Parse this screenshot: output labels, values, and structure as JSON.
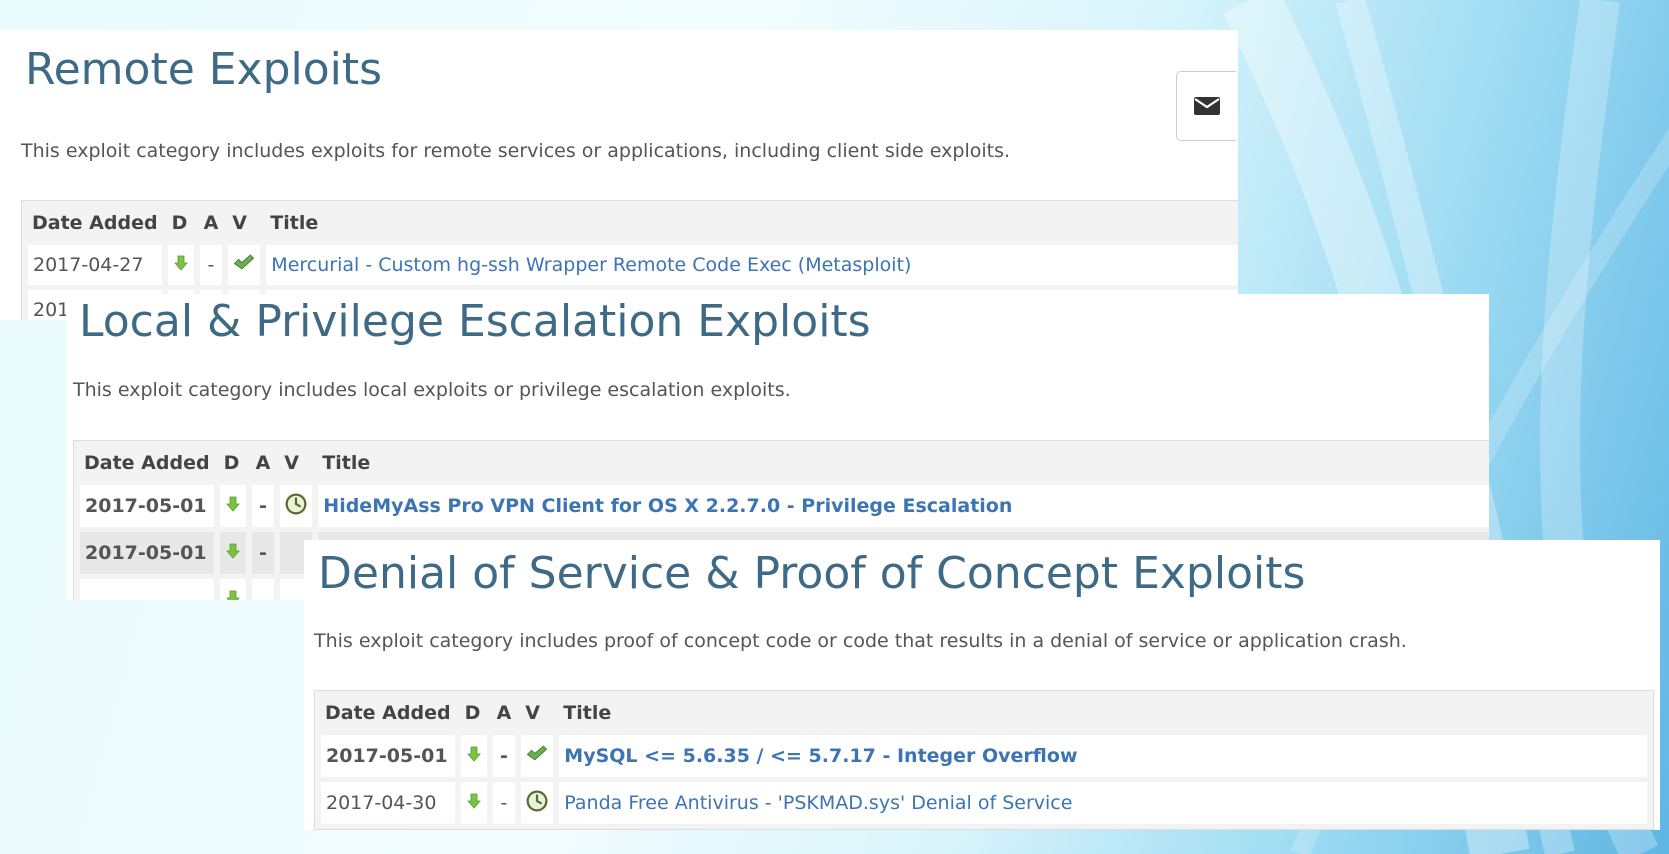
{
  "remote": {
    "title": "Remote Exploits",
    "description": "This exploit category includes exploits for remote services or applications, including client side exploits.",
    "columns": [
      "Date Added",
      "D",
      "A",
      "V",
      "Title"
    ],
    "rows": [
      {
        "date": "2017-04-27",
        "a": "-",
        "verified": "check-icon",
        "title": "Mercurial - Custom hg-ssh Wrapper Remote Code Exec (Metasploit)"
      },
      {
        "date": "201",
        "a": "",
        "verified": "",
        "title": ""
      }
    ]
  },
  "local": {
    "title": "Local & Privilege Escalation Exploits",
    "description": "This exploit category includes local exploits or privilege escalation exploits.",
    "columns": [
      "Date Added",
      "D",
      "A",
      "V",
      "Title"
    ],
    "rows": [
      {
        "date": "2017-05-01",
        "a": "-",
        "verified": "clock-icon",
        "title": "HideMyAss Pro VPN Client for OS X 2.2.7.0 - Privilege Escalation"
      },
      {
        "date": "2017-05-01",
        "a": "-",
        "verified": "",
        "title": ""
      }
    ]
  },
  "dos": {
    "title": "Denial of Service & Proof of Concept Exploits",
    "description": "This exploit category includes proof of concept code or code that results in a denial of service or application crash.",
    "columns": [
      "Date Added",
      "D",
      "A",
      "V",
      "Title"
    ],
    "rows": [
      {
        "date": "2017-05-01",
        "a": "-",
        "verified": "check-icon",
        "title": "MySQL <= 5.6.35 / <= 5.7.17 - Integer Overflow"
      },
      {
        "date": "2017-04-30",
        "a": "-",
        "verified": "clock-icon",
        "title": "Panda Free Antivirus - 'PSKMAD.sys' Denial of Service"
      }
    ]
  },
  "icons": {
    "download": "download-arrow-icon",
    "mail": "envelope-icon"
  },
  "colors": {
    "heading": "#3e6a86",
    "link": "#3c74b4",
    "download": "#7cc243",
    "verified": "#6ab04c"
  }
}
